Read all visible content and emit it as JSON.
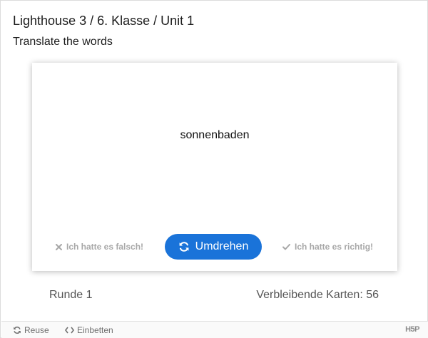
{
  "header": {
    "title": "Lighthouse 3 / 6. Klasse / Unit 1",
    "subtitle": "Translate the words"
  },
  "card": {
    "word": "sonnenbaden",
    "wrong_label": "Ich hatte es falsch!",
    "turn_label": "Umdrehen",
    "right_label": "Ich hatte es richtig!"
  },
  "status": {
    "round": "Runde 1",
    "remaining": "Verbleibende Karten: 56"
  },
  "footer": {
    "reuse_label": "Reuse",
    "embed_label": "Einbetten",
    "logo_text": "H5P"
  },
  "colors": {
    "accent": "#1a73d9",
    "muted": "#a8a8a8"
  },
  "icons": {
    "wrong": "close-icon",
    "turn": "refresh-icon",
    "right": "check-icon",
    "reuse": "refresh-icon",
    "embed": "code-icon"
  }
}
